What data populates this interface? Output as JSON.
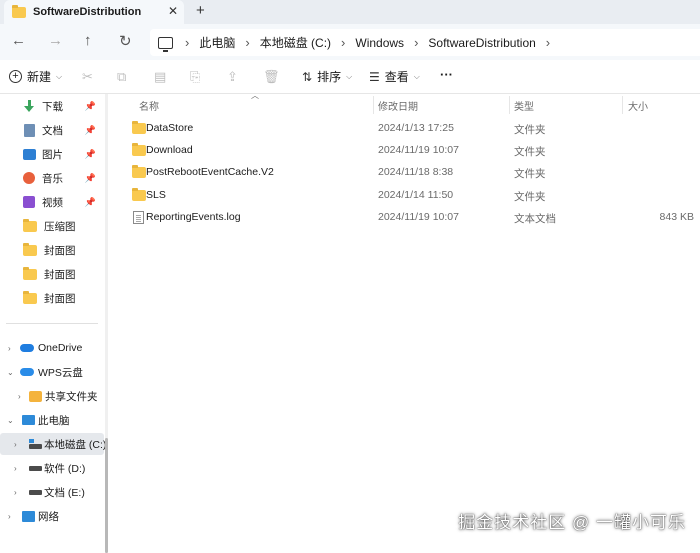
{
  "window": {
    "tab_title": "SoftwareDistribution",
    "tab_close": "✕",
    "new_tab": "+"
  },
  "nav": {
    "back": "←",
    "forward": "→",
    "up": "↑",
    "refresh": "↻"
  },
  "address": {
    "crumbs": [
      "此电脑",
      "本地磁盘 (C:)",
      "Windows",
      "SoftwareDistribution"
    ],
    "separator": "›"
  },
  "toolbar": {
    "new_label": "新建",
    "sort_label": "排序",
    "view_label": "查看",
    "more_label": "···"
  },
  "sidebar": {
    "quick_access": [
      {
        "label": "下载",
        "icon": "download-icon",
        "pinned": true
      },
      {
        "label": "文档",
        "icon": "document-icon",
        "pinned": true
      },
      {
        "label": "图片",
        "icon": "picture-icon",
        "pinned": true
      },
      {
        "label": "音乐",
        "icon": "music-icon",
        "pinned": true
      },
      {
        "label": "视频",
        "icon": "video-icon",
        "pinned": true
      },
      {
        "label": "压缩图",
        "icon": "folder-icon",
        "pinned": false
      },
      {
        "label": "封面图",
        "icon": "folder-icon",
        "pinned": false
      },
      {
        "label": "封面图",
        "icon": "folder-icon",
        "pinned": false
      },
      {
        "label": "封面图",
        "icon": "folder-icon",
        "pinned": false
      }
    ],
    "tree": [
      {
        "label": "OneDrive",
        "icon": "onedrive-icon"
      },
      {
        "label": "WPS云盘",
        "icon": "wps-cloud-icon"
      },
      {
        "label": "共享文件夹",
        "icon": "shared-folder-icon"
      },
      {
        "label": "此电脑",
        "icon": "this-pc-icon"
      },
      {
        "label": "本地磁盘 (C:)",
        "icon": "drive-icon",
        "selected": true
      },
      {
        "label": "软件 (D:)",
        "icon": "drive-icon"
      },
      {
        "label": "文档 (E:)",
        "icon": "drive-icon"
      },
      {
        "label": "网络",
        "icon": "network-icon"
      }
    ]
  },
  "files": {
    "columns": {
      "name": "名称",
      "modified": "修改日期",
      "type": "类型",
      "size": "大小"
    },
    "rows": [
      {
        "name": "DataStore",
        "modified": "2024/1/13 17:25",
        "type": "文件夹",
        "size": "",
        "icon": "folder-icon"
      },
      {
        "name": "Download",
        "modified": "2024/11/19 10:07",
        "type": "文件夹",
        "size": "",
        "icon": "folder-icon"
      },
      {
        "name": "PostRebootEventCache.V2",
        "modified": "2024/11/18 8:38",
        "type": "文件夹",
        "size": "",
        "icon": "folder-icon"
      },
      {
        "name": "SLS",
        "modified": "2024/1/14 11:50",
        "type": "文件夹",
        "size": "",
        "icon": "folder-icon"
      },
      {
        "name": "ReportingEvents.log",
        "modified": "2024/11/19 10:07",
        "type": "文本文档",
        "size": "843 KB",
        "icon": "text-file-icon"
      }
    ]
  },
  "watermark": "掘金技术社区 @ 一罐小可乐"
}
